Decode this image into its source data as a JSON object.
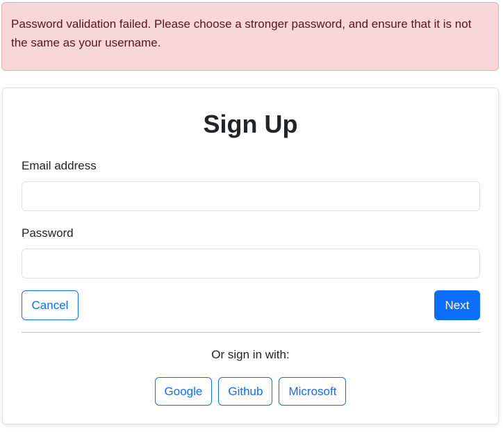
{
  "alert": {
    "message": "Password validation failed. Please choose a stronger password, and ensure that it is not the same as your username."
  },
  "form": {
    "title": "Sign Up",
    "email_label": "Email address",
    "email_value": "",
    "password_label": "Password",
    "password_value": "",
    "cancel_label": "Cancel",
    "next_label": "Next"
  },
  "social": {
    "prompt": "Or sign in with:",
    "providers": [
      "Google",
      "Github",
      "Microsoft"
    ]
  },
  "colors": {
    "primary": "#0d6efd",
    "alert_bg": "#f8d7da",
    "alert_text": "#58151c"
  }
}
